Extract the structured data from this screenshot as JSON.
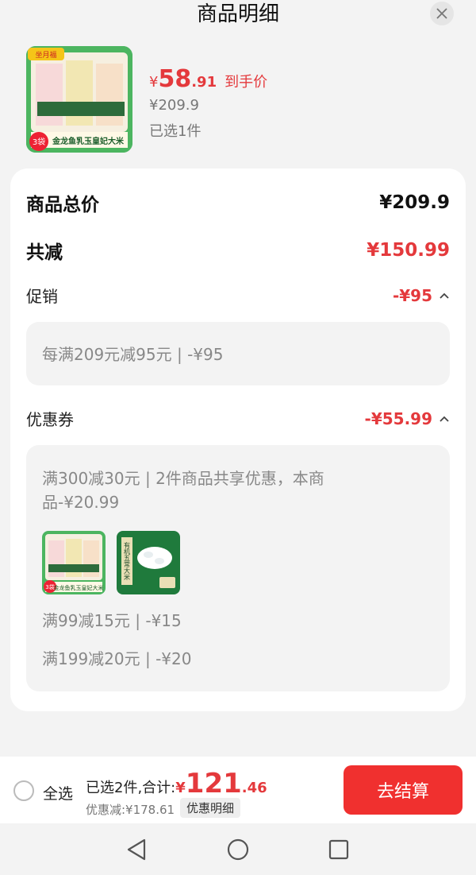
{
  "header": {
    "title": "商品明细"
  },
  "product": {
    "price_symbol": "¥",
    "price_int": "58",
    "price_dec": ".91",
    "price_label": "到手价",
    "original_price": "¥209.9",
    "selected_count": "已选1件",
    "thumb_top_badge": "坐月福",
    "thumb_bag_count": "3袋",
    "thumb_caption": "金龙鱼乳玉皇妃大米"
  },
  "summary": {
    "total_label": "商品总价",
    "total_value": "¥209.9",
    "reduction_label": "共减",
    "reduction_value": "¥150.99"
  },
  "promotion": {
    "label": "促销",
    "value": "-¥95",
    "detail": "每满209元减95元 | -¥95"
  },
  "coupon": {
    "label": "优惠券",
    "value": "-¥55.99",
    "detail_line1": "满300减30元 | 2件商品共享优惠，本商",
    "detail_line2": "品-¥20.99",
    "item2_text": "有机五常大米",
    "item1_bag_count": "3袋",
    "item1_caption": "金龙鱼乳玉皇妃大米",
    "rule2": "满99减15元 | -¥15",
    "rule3": "满199减20元 | -¥20"
  },
  "bottom": {
    "select_all": "全选",
    "total_prefix": "已选2件,合计:",
    "total_symbol": "¥",
    "total_int": "121",
    "total_dec": ".46",
    "discount_text": "优惠减:¥178.61",
    "detail_button": "优惠明细",
    "checkout_button": "去结算"
  },
  "colors": {
    "accent": "#e4393c",
    "checkout": "#f0302f"
  }
}
